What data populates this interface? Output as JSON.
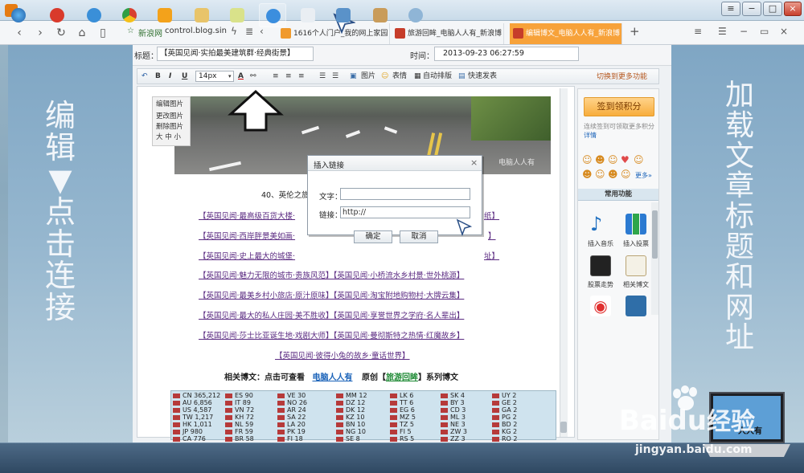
{
  "nav": {
    "fav_label": "新浪网",
    "address": "control.blog.sin",
    "tabs": [
      {
        "label": "1616个人门户_我的网上家园"
      },
      {
        "label": "旅游回眸_电脑人人有_新浪博"
      },
      {
        "label": "编辑博文_电脑人人有_新浪博"
      }
    ],
    "new_tab": "+"
  },
  "editor_meta": {
    "title_label": "标题：",
    "title_value": "【英国见闻·实拍最美建筑群·经典街景】",
    "time_label": "时间：",
    "time_value": "2013-09-23 06:27:59"
  },
  "toolbar": {
    "bold": "B",
    "italic": "I",
    "underline": "U",
    "font_size": "14px",
    "font_color": "A",
    "image": "图片",
    "emotion": "表情",
    "auto_layout": "自动排版",
    "quick_post": "快速发表",
    "more": "切换到更多功能"
  },
  "image_menu": {
    "title": "编辑图片",
    "change": "更改图片",
    "delete": "删除图片",
    "size": "大 中 小"
  },
  "photo_watermark": "电脑人人有",
  "content": {
    "caption": "40、英伦之旅",
    "links": [
      "【英国见闻·最高级百货大楼·",
      "【英国见闻·西岸胖景美如画·",
      "【英国见闻·史上最大的城堡·",
      "【英国见闻·魅力无限的城市·贵族风范】【英国见闻·小桥流水乡村景·世外桃源】",
      "【英国见闻·最美乡村小旅店·原汁原味】【英国见闻·淘宝附地购物村·大牌云集】",
      "【英国见闻·最大的私人庄园·美不胜收】【英国见闻·享誉世界之学府·名人辈出】",
      "【英国见闻·莎士比亚诞生地·戏剧大师】【英国见闻·曼彻斯特之热情·红魔故乡】",
      "【英国见闻·彼得小兔的故乡·童话世界】"
    ],
    "links_right": [
      "纸】",
      "】",
      "址】"
    ],
    "related_prefix": "相关博文：点击可查看",
    "related_author": "电脑人人有",
    "related_mid": "原创【",
    "related_series": "旅游回眸",
    "related_suffix": "】系列博文"
  },
  "flags": [
    [
      "CN 365,212",
      "AU 6,856",
      "US 4,587",
      "TW 1,217",
      "HK 1,011",
      "JP 980",
      "CA 776"
    ],
    [
      "ES 90",
      "IT 89",
      "VN 72",
      "KH 72",
      "NL 59",
      "FR 59",
      "BR 58"
    ],
    [
      "VE 30",
      "NO 26",
      "AR 24",
      "SA 22",
      "LA 20",
      "PK 19",
      "FI 18"
    ],
    [
      "MM 12",
      "DZ 12",
      "DK 12",
      "KZ 10",
      "BN 10",
      "NG 10",
      "SE 8"
    ],
    [
      "LK 6",
      "TT 6",
      "EG 6",
      "MZ 5",
      "TZ 5",
      "FI 5",
      "RS 5"
    ],
    [
      "SK 4",
      "BY 3",
      "CD 3",
      "ML 3",
      "NE 3",
      "ZW 3",
      "ZZ 3"
    ],
    [
      "UY 2",
      "GE 2",
      "GA 2",
      "PG 2",
      "BD 2",
      "KG 2",
      "RO 2"
    ]
  ],
  "right_panel": {
    "sign_in": "签到领积分",
    "sign_note": "连续签到可领取更多积分",
    "details": "详情",
    "emoji_more": "更多»",
    "section_title": "常用功能",
    "features": [
      "插入音乐",
      "插入投票",
      "股票走势",
      "相关博文"
    ]
  },
  "dialog": {
    "title": "插入链接",
    "close": "×",
    "text_label": "文字：",
    "text_value": "",
    "link_label": "链接：",
    "link_value": "http://",
    "ok": "确定",
    "cancel": "取消"
  },
  "left_note": "编辑▼点击连接",
  "right_note": "加载文章标题和网址",
  "watermark": {
    "brand": "Bai",
    "brand_du": "du",
    "jy": "经验",
    "url": "jingyan.baidu.com",
    "laptop_label": "人人有"
  }
}
